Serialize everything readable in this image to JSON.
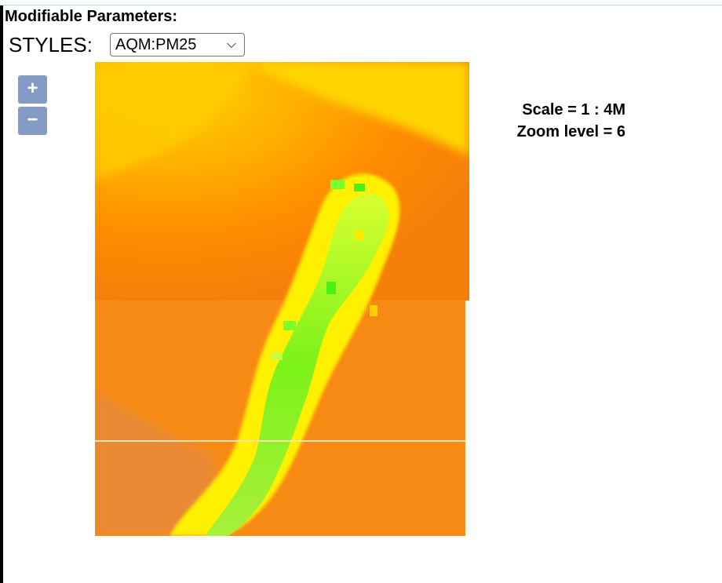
{
  "heading": "Modifiable Parameters:",
  "styles": {
    "label": "STYLES:",
    "selected": "AQM:PM25"
  },
  "zoom_controls": {
    "in_label": "+",
    "out_label": "−"
  },
  "scale_info": {
    "scale": "Scale = 1 : 4M",
    "zoom": "Zoom level = 6"
  },
  "map": {
    "layer_colors": {
      "low": "#00e400",
      "moderate": "#ffff00",
      "elevated": "#ffd700",
      "high": "#ff7e00"
    }
  }
}
